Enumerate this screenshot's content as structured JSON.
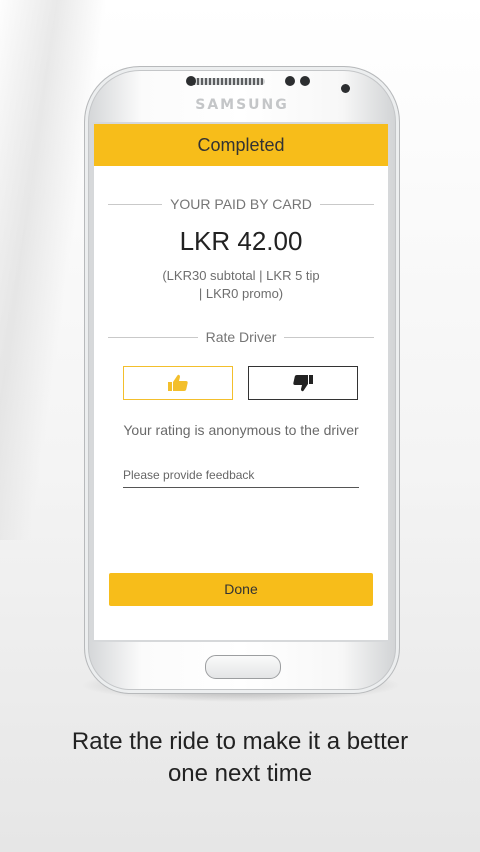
{
  "phone": {
    "brand": "SAMSUNG"
  },
  "screen": {
    "header_title": "Completed",
    "payment_label": "YOUR PAID BY CARD",
    "amount": "LKR 42.00",
    "breakdown_line1": "(LKR30 subtotal  |  LKR 5 tip",
    "breakdown_line2": "|  LKR0  promo)",
    "rate_label": "Rate Driver",
    "thumbs_up_icon": "thumbs-up-icon",
    "thumbs_down_icon": "thumbs-down-icon",
    "anonymous_note": "Your rating is anonymous to the driver",
    "feedback_placeholder": "Please provide feedback",
    "done_label": "Done"
  },
  "caption": {
    "line1": "Rate the ride to make it a better",
    "line2": "one next time"
  },
  "colors": {
    "accent": "#f7bd1a",
    "thumb_up": "#f3bf2c",
    "text_dark": "#333333"
  }
}
